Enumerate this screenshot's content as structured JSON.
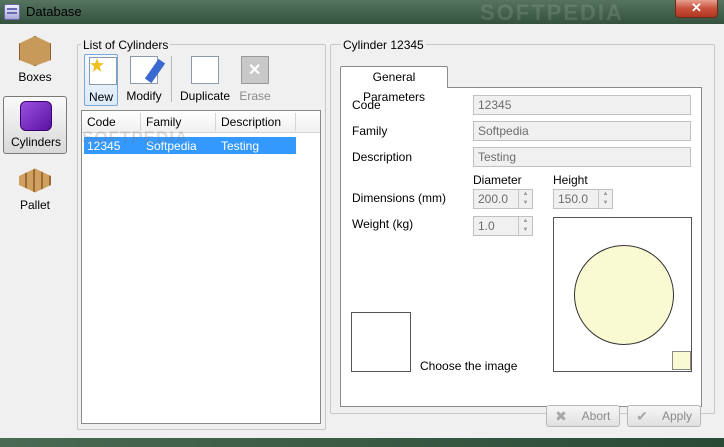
{
  "window": {
    "title": "Database",
    "close_glyph": "✕",
    "watermark": "SOFTPEDIA"
  },
  "nav": {
    "items": [
      {
        "label": "Boxes",
        "icon": "box-icon",
        "selected": false
      },
      {
        "label": "Cylinders",
        "icon": "cylinder-icon",
        "selected": true
      },
      {
        "label": "Pallet",
        "icon": "pallet-icon",
        "selected": false
      }
    ]
  },
  "list": {
    "title": "List of Cylinders",
    "toolbar": {
      "new_label": "New",
      "modify_label": "Modify",
      "duplicate_label": "Duplicate",
      "erase_label": "Erase"
    },
    "columns": [
      "Code",
      "Family",
      "Description"
    ],
    "rows": [
      {
        "code": "12345",
        "family": "Softpedia",
        "description": "Testing",
        "selected": true
      }
    ],
    "watermark": "SOFTPEDIA"
  },
  "detail": {
    "title": "Cylinder 12345",
    "tab_label": "General Parameters",
    "code_label": "Code",
    "code_value": "12345",
    "family_label": "Family",
    "family_value": "Softpedia",
    "description_label": "Description",
    "description_value": "Testing",
    "dimensions_label": "Dimensions (mm)",
    "diameter_label": "Diameter",
    "diameter_value": "200.0",
    "height_label": "Height",
    "height_value": "150.0",
    "weight_label": "Weight (kg)",
    "weight_value": "1.0",
    "choose_image_label": "Choose the image",
    "preview_fill_color": "#fafad2"
  },
  "buttons": {
    "abort_label": "Abort",
    "apply_label": "Apply"
  }
}
